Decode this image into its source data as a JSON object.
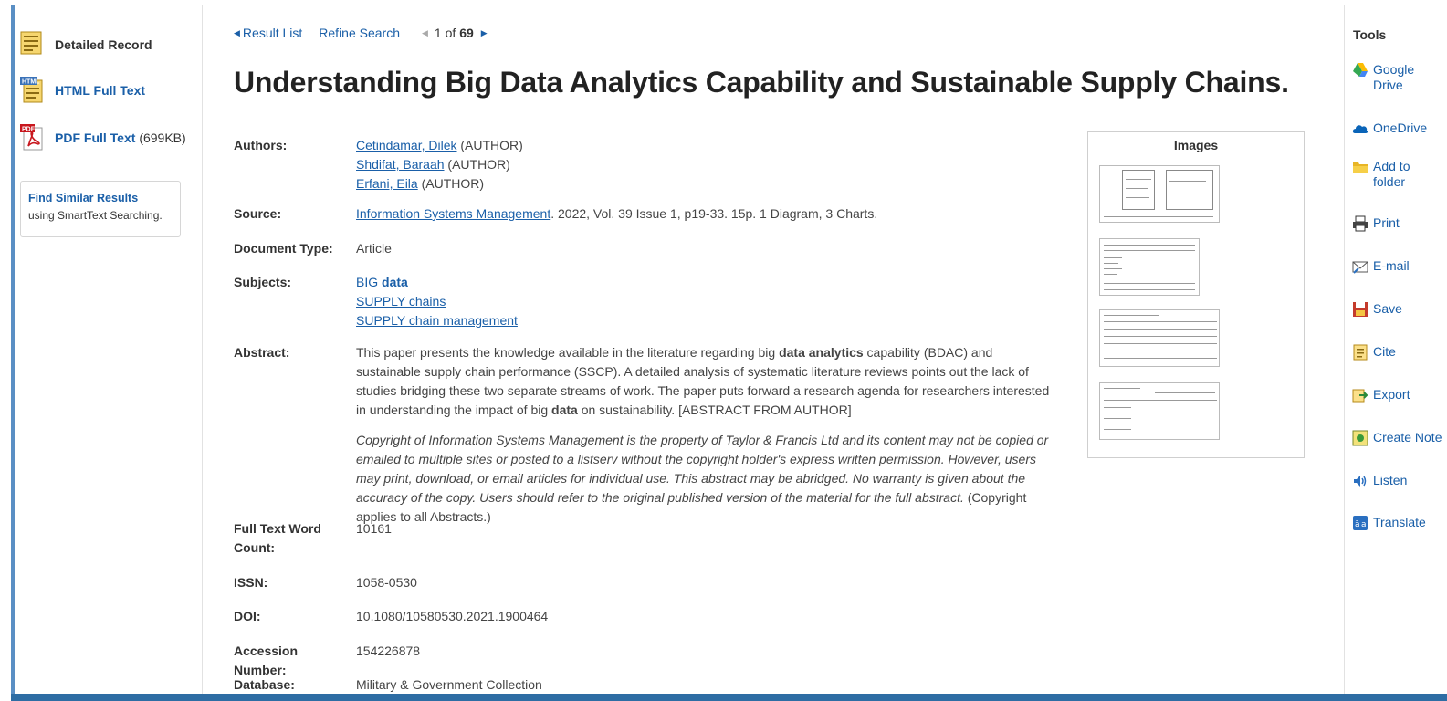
{
  "left_nav": {
    "detailed_record": "Detailed Record",
    "html_full_text": "HTML Full Text",
    "pdf_full_text": "PDF Full Text",
    "pdf_size": "(699KB)",
    "html_badge": "HTML",
    "pdf_badge": "PDF",
    "find_similar": "Find Similar Results",
    "find_similar_sub": "using SmartText Searching."
  },
  "topnav": {
    "result_list": "Result List",
    "refine_search": "Refine Search",
    "position": "1 of 69",
    "position_current": "1",
    "position_total": "69"
  },
  "record": {
    "title": "Understanding Big Data Analytics Capability and Sustainable Supply Chains.",
    "labels": {
      "authors": "Authors:",
      "source": "Source:",
      "doc_type": "Document Type:",
      "subjects": "Subjects:",
      "abstract": "Abstract:",
      "word_count": "Full Text Word Count:",
      "issn": "ISSN:",
      "doi": "DOI:",
      "accession": "Accession Number:",
      "database": "Database:"
    },
    "authors": [
      {
        "name": "Cetindamar, Dilek",
        "role": "(AUTHOR)"
      },
      {
        "name": "Shdifat, Baraah",
        "role": "(AUTHOR)"
      },
      {
        "name": "Erfani, Eila",
        "role": "(AUTHOR)"
      }
    ],
    "source_link": "Information Systems Management",
    "source_rest": ". 2022, Vol. 39 Issue 1, p19-33. 15p. 1 Diagram, 3 Charts.",
    "doc_type": "Article",
    "subjects": [
      {
        "plain": "BIG ",
        "bold": "data"
      },
      {
        "plain": "SUPPLY chains",
        "bold": ""
      },
      {
        "plain": "SUPPLY chain management",
        "bold": ""
      }
    ],
    "abstract_parts": [
      "This paper presents the knowledge available in the literature regarding big ",
      "data analytics",
      " capability (BDAC) and sustainable supply chain performance (SSCP). A detailed analysis of systematic literature reviews points out the lack of studies bridging these two separate streams of work. The paper puts forward a research agenda for researchers interested in understanding the impact of big ",
      "data",
      " on sustainability. [ABSTRACT FROM AUTHOR]"
    ],
    "copyright_italic": "Copyright of Information Systems Management is the property of Taylor & Francis Ltd and its content may not be copied or emailed to multiple sites or posted to a listserv without the copyright holder's express written permission. However, users may print, download, or email articles for individual use. This abstract may be abridged. No warranty is given about the accuracy of the copy. Users should refer to the original published version of the material for the full abstract.",
    "copyright_plain": " (Copyright applies to all Abstracts.)",
    "word_count": "10161",
    "issn": "1058-0530",
    "doi": "10.1080/10580530.2021.1900464",
    "accession": "154226878",
    "database": "Military & Government Collection"
  },
  "images_panel": {
    "heading": "Images"
  },
  "tools": {
    "heading": "Tools",
    "items": [
      {
        "label": "Google\nDrive",
        "icon": "google-drive-icon"
      },
      {
        "label": "OneDrive",
        "icon": "onedrive-icon"
      },
      {
        "label": "Add to\nfolder",
        "icon": "folder-icon"
      },
      {
        "label": "Print",
        "icon": "printer-icon"
      },
      {
        "label": "E-mail",
        "icon": "email-icon"
      },
      {
        "label": "Save",
        "icon": "save-icon"
      },
      {
        "label": "Cite",
        "icon": "cite-icon"
      },
      {
        "label": "Export",
        "icon": "export-icon"
      },
      {
        "label": "Create Note",
        "icon": "note-icon"
      },
      {
        "label": "Listen",
        "icon": "speaker-icon"
      },
      {
        "label": "Translate",
        "icon": "translate-icon"
      }
    ]
  },
  "colors": {
    "link": "#1a5fa8",
    "accent_bar": "#2e6da4"
  }
}
